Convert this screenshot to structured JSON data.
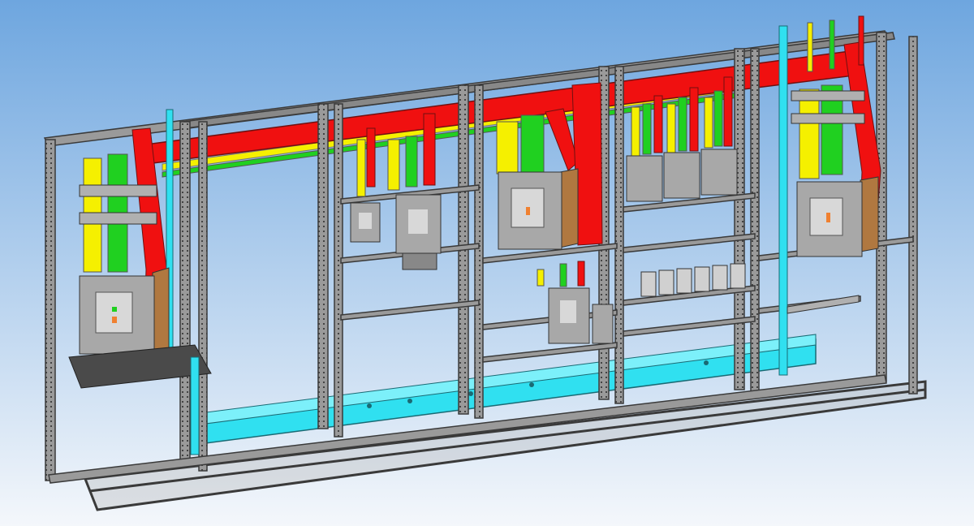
{
  "scene": {
    "description_visible_text": "",
    "colors": {
      "background_top": "#6ea6df",
      "background_bottom": "#f4f7fb",
      "frame": "#9a9a9a",
      "frame_dark": "#3a3a3a",
      "busbar_red": "#f01010",
      "busbar_yellow": "#f5f000",
      "busbar_green": "#20d020",
      "busbar_cyan": "#30e0f0",
      "breaker_body": "#a8a8a8",
      "breaker_side": "#b07840",
      "breaker_window": "#d8d8d8"
    },
    "cabinet_sections": 6,
    "breaker_icons": [
      "circuit-breaker-icon",
      "small-breaker-icon"
    ]
  }
}
